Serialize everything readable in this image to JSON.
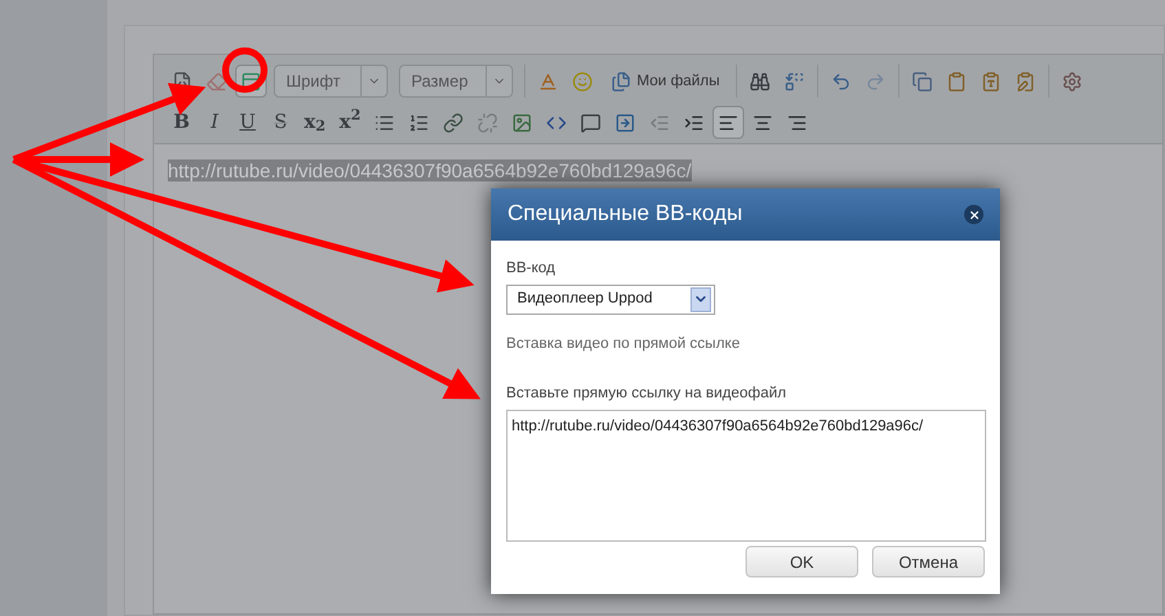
{
  "toolbar": {
    "row_1": [
      {
        "kind": "source",
        "disabled": false,
        "selected": false
      },
      {
        "kind": "eraser",
        "disabled": false,
        "selected": false
      },
      {
        "kind": "bbcode",
        "disabled": false,
        "selected": true
      },
      {
        "kind": "select",
        "label": "Шрифт"
      },
      {
        "kind": "select",
        "label": "Размер"
      },
      {
        "kind": "sep"
      },
      {
        "kind": "color",
        "disabled": false,
        "selected": false
      },
      {
        "kind": "smiley",
        "disabled": false,
        "selected": false
      },
      {
        "kind": "files",
        "label": "Мои файлы"
      },
      {
        "kind": "sep"
      },
      {
        "kind": "find",
        "disabled": false,
        "selected": false
      },
      {
        "kind": "replace",
        "disabled": false,
        "selected": false
      },
      {
        "kind": "sep"
      },
      {
        "kind": "undo",
        "disabled": false,
        "selected": false
      },
      {
        "kind": "redo",
        "disabled": true,
        "selected": false
      },
      {
        "kind": "sep"
      },
      {
        "kind": "copy",
        "disabled": false,
        "selected": false
      },
      {
        "kind": "paste",
        "disabled": false,
        "selected": false
      },
      {
        "kind": "paste_text",
        "disabled": false,
        "selected": false
      },
      {
        "kind": "paste_word",
        "disabled": false,
        "selected": false
      },
      {
        "kind": "sep"
      },
      {
        "kind": "remove_format",
        "disabled": false,
        "selected": false
      }
    ],
    "row_2": [
      {
        "kind": "text",
        "label": "B",
        "disabled": false,
        "selected": false
      },
      {
        "kind": "text",
        "label": "I",
        "disabled": false,
        "selected": false
      },
      {
        "kind": "text",
        "label": "U",
        "disabled": false,
        "selected": false
      },
      {
        "kind": "text",
        "label": "S",
        "disabled": false,
        "selected": false
      },
      {
        "kind": "text",
        "label": "x$_{2}$",
        "disabled": false,
        "selected": false
      },
      {
        "kind": "text",
        "label": "x$^{2}$",
        "disabled": false,
        "selected": false
      },
      {
        "kind": "bullets",
        "disabled": false,
        "selected": false
      },
      {
        "kind": "numbers",
        "disabled": false,
        "selected": false
      },
      {
        "kind": "link",
        "disabled": false,
        "selected": false
      },
      {
        "kind": "unlink",
        "disabled": true,
        "selected": false
      },
      {
        "kind": "image",
        "disabled": false,
        "selected": false
      },
      {
        "kind": "code",
        "disabled": false,
        "selected": false
      },
      {
        "kind": "quote",
        "disabled": false,
        "selected": false
      },
      {
        "kind": "media",
        "disabled": false,
        "selected": false
      },
      {
        "kind": "outdent",
        "disabled": true,
        "selected": false
      },
      {
        "kind": "indent",
        "disabled": false,
        "selected": false
      },
      {
        "kind": "align_left",
        "disabled": false,
        "selected": true
      },
      {
        "kind": "align_center",
        "disabled": false,
        "selected": false
      },
      {
        "kind": "align_right",
        "disabled": false,
        "selected": false
      }
    ]
  },
  "editor": {
    "text": "http://rutube.ru/video/04436307f90a6564b92e760bd129a96c/",
    "selected": true
  },
  "dialog": {
    "title": "Специальные BB-коды",
    "field_label": "BB-код",
    "select_value": "Видеоплеер Uppod",
    "description": "Вставка видео по прямой ссылке",
    "link_label": "Вставьте прямую ссылку на видеофайл",
    "link_value": "http://rutube.ru/video/04436307f90a6564b92e760bd129a96c/",
    "buttons": [
      "OK",
      "Отмена"
    ]
  }
}
